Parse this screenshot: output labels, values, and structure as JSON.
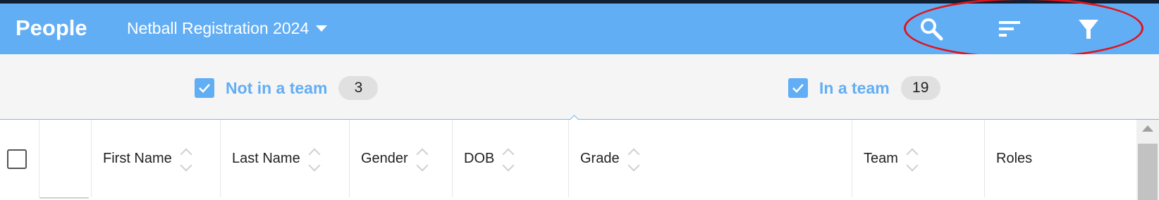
{
  "appbar": {
    "title": "People",
    "event_selector": "Netball Registration 2024",
    "icons": [
      "search-icon",
      "sort-icon",
      "filter-icon"
    ],
    "background_color": "#62aef5"
  },
  "filters": [
    {
      "label": "Not in a team",
      "count": "3",
      "checked": true
    },
    {
      "label": "In a team",
      "count": "19",
      "checked": true
    }
  ],
  "table": {
    "columns": [
      "First Name",
      "Last Name",
      "Gender",
      "DOB",
      "Grade",
      "Team",
      "Roles"
    ]
  },
  "annotation": {
    "color": "#e0141c"
  }
}
